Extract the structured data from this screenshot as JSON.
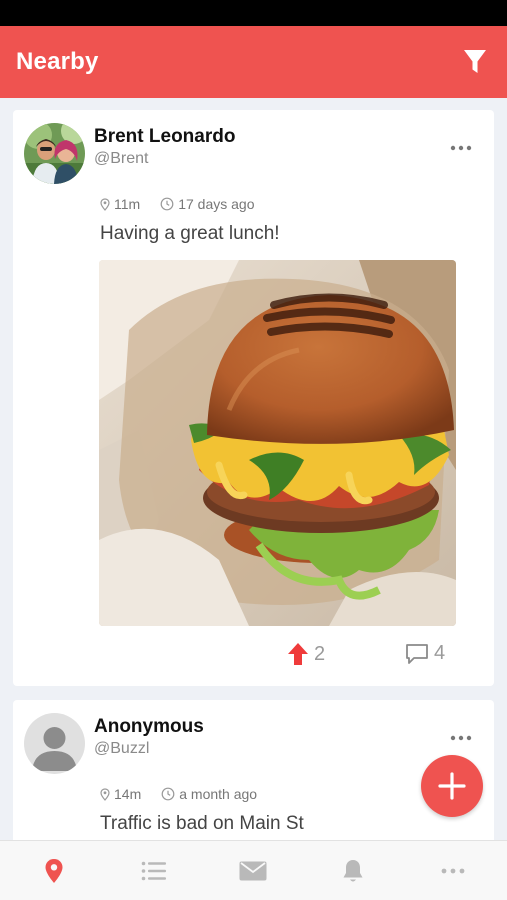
{
  "header": {
    "title": "Nearby"
  },
  "posts": [
    {
      "name": "Brent Leonardo",
      "handle": "@Brent",
      "distance": "11m",
      "time": "17 days ago",
      "text": "Having a great lunch!",
      "upvotes": "2",
      "comments": "4"
    },
    {
      "name": "Anonymous",
      "handle": "@Buzzl",
      "distance": "14m",
      "time": "a month ago",
      "text": "Traffic is bad on Main St"
    }
  ],
  "icons": {
    "filter": "filter-icon",
    "more": "more-icon",
    "location": "location-pin-icon",
    "clock": "clock-icon",
    "upvote": "arrow-up-icon",
    "comment": "comment-icon",
    "add": "plus-icon",
    "tabs": [
      "location-pin-icon",
      "list-icon",
      "mail-icon",
      "bell-icon",
      "more-icon"
    ]
  },
  "colors": {
    "accent": "#ef5350",
    "active_tab": "#ef5350",
    "inactive_tab": "#b9b9b9"
  }
}
